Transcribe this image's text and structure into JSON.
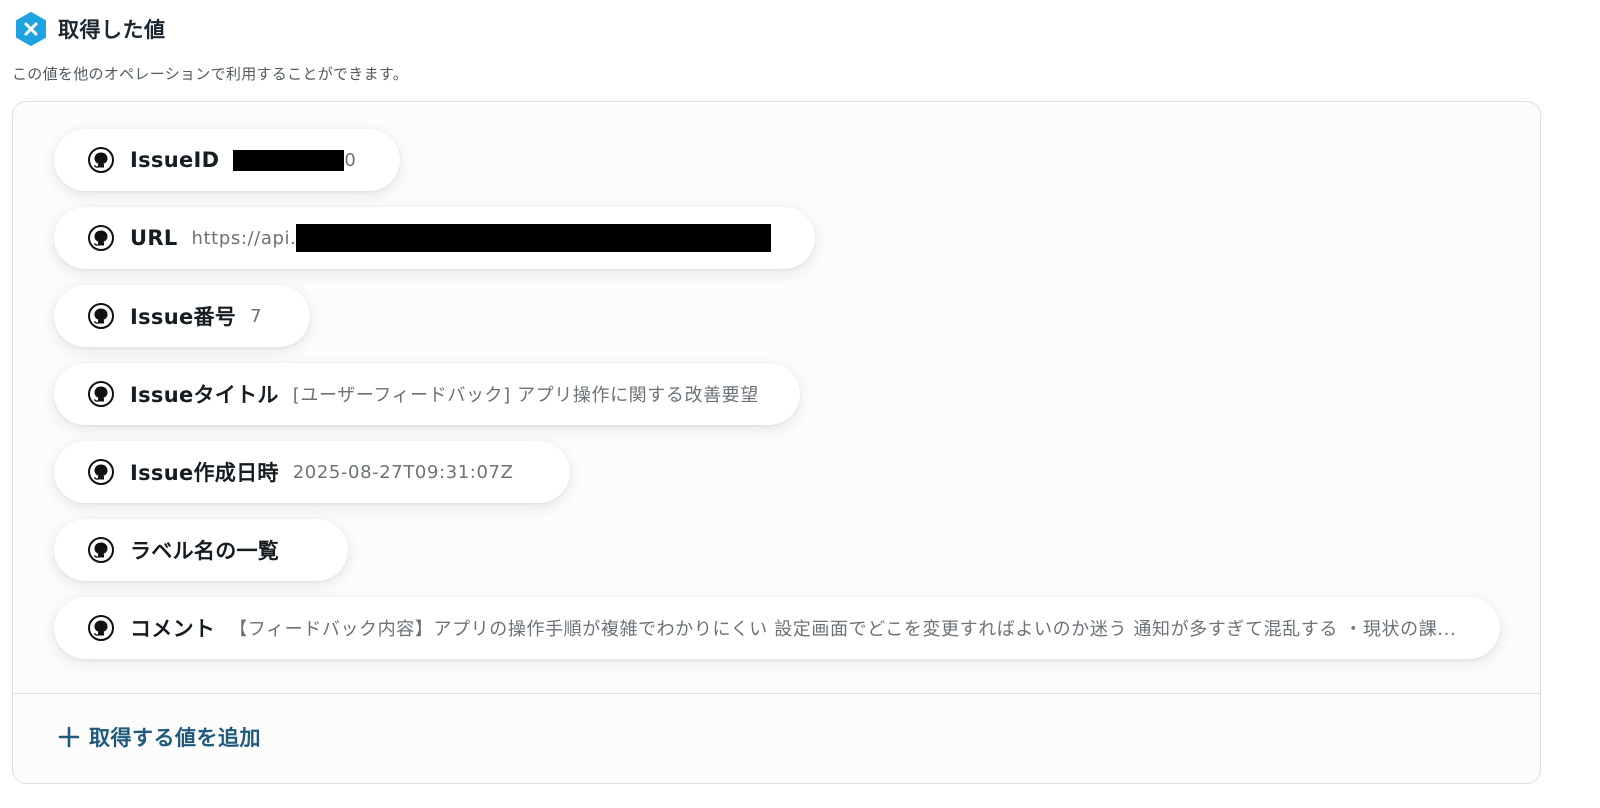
{
  "header": {
    "title": "取得した値",
    "icon": "x-badge-icon",
    "icon_color": "#1fa2e0"
  },
  "subtitle": "この値を他のオペレーションで利用することができます。",
  "fields": [
    {
      "label": "IssueID",
      "value": "0",
      "redacted": true,
      "icon": "github-icon"
    },
    {
      "label": "URL",
      "value": "https://api.",
      "redacted": true,
      "icon": "github-icon"
    },
    {
      "label": "Issue番号",
      "value": "7",
      "icon": "github-icon"
    },
    {
      "label": "Issueタイトル",
      "value": "[ユーザーフィードバック] アプリ操作に関する改善要望",
      "icon": "github-icon"
    },
    {
      "label": "Issue作成日時",
      "value": "2025-08-27T09:31:07Z",
      "icon": "github-icon"
    },
    {
      "label": "ラベル名の一覧",
      "value": "",
      "icon": "github-icon"
    },
    {
      "label": "コメント",
      "value": "【フィードバック内容】アプリの操作手順が複雑でわかりにくい 設定画面でどこを変更すればよいのか迷う 通知が多すぎて混乱する ・現状の課...",
      "icon": "github-icon"
    }
  ],
  "add_button": {
    "label": "取得する値を追加",
    "icon": "plus-icon",
    "color": "#1f5a7a"
  }
}
